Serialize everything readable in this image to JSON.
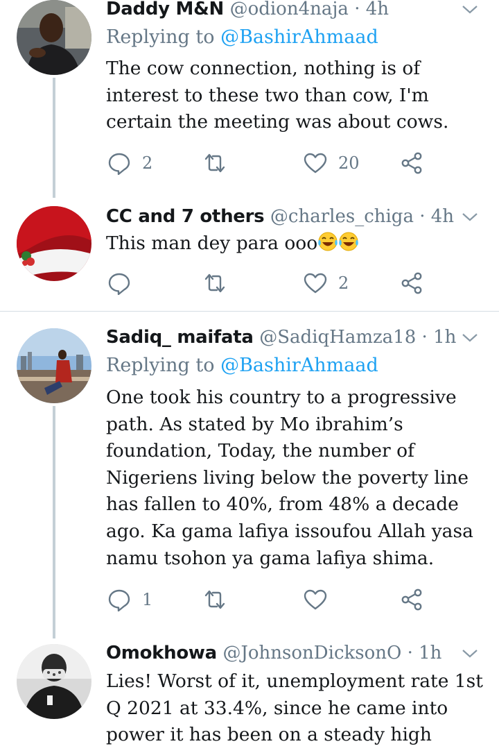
{
  "tweets": [
    {
      "name": "Daddy M&N",
      "handle": "@odion4naja",
      "time": "4h",
      "replying_prefix": "Replying to ",
      "replying_to": "@BashirAhmaad",
      "lines": [
        "The cow connection, nothing is of",
        "interest to these two than cow, I'm",
        "certain the meeting was about cows."
      ],
      "reply_count": "2",
      "retweet_count": "",
      "like_count": "20"
    },
    {
      "name": "CC and 7 others",
      "handle": "@charles_chiga",
      "time": "4h",
      "lines": [
        "This man dey para ooo"
      ],
      "reply_count": "",
      "retweet_count": "",
      "like_count": "2"
    },
    {
      "name": "Sadiq_ maifata",
      "handle": "@SadiqHamza18",
      "time": "1h",
      "replying_prefix": "Replying to ",
      "replying_to": "@BashirAhmaad",
      "lines": [
        "One took his country to a progressive",
        "path. As stated by Mo ibrahim’s",
        "foundation, Today,  the number of",
        "Nigeriens living below the poverty line",
        "has fallen to 40%, from 48% a decade",
        "ago. Ka gama lafiya issoufou Allah yasa",
        "namu tsohon ya gama lafiya shima."
      ],
      "reply_count": "1",
      "retweet_count": "",
      "like_count": ""
    },
    {
      "name": "Omokhowa",
      "handle": "@JohnsonDicksonO",
      "time": "1h",
      "lines": [
        "Lies! Worst of it, unemployment rate 1st",
        "Q 2021 at 33.4%, since he came into",
        "power it has been on a steady high"
      ]
    }
  ],
  "separator": " · ",
  "icons": {
    "reply": "reply-icon",
    "retweet": "retweet-icon",
    "like": "like-icon",
    "share": "share-icon",
    "more": "chevron-down-icon"
  },
  "colors": {
    "text": "#14171a",
    "secondary": "#657786",
    "link": "#1da1f2",
    "thread_line": "#c4cfd6"
  }
}
